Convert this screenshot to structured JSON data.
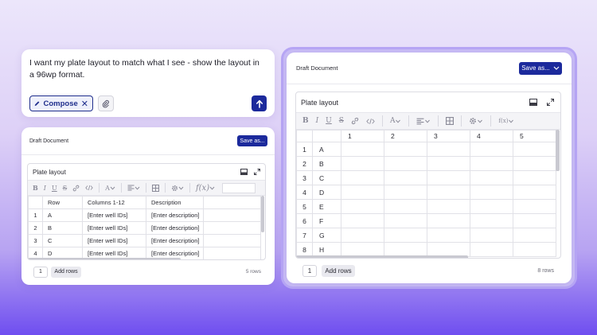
{
  "prompt": {
    "text": "I want my plate layout to match what I see - show the layout in a 96wp format.",
    "compose_label": "Compose",
    "compose_close": "✕"
  },
  "doc_small": {
    "title": "Draft Document",
    "save_label": "Save as...",
    "panel_title": "Plate layout",
    "columns": [
      "Row",
      "Columns 1-12",
      "Description"
    ],
    "rows": [
      {
        "num": "1",
        "row": "A",
        "cols": "[Enter well IDs]",
        "desc": "[Enter description]"
      },
      {
        "num": "2",
        "row": "B",
        "cols": "[Enter well IDs]",
        "desc": "[Enter description]"
      },
      {
        "num": "3",
        "row": "C",
        "cols": "[Enter well IDs]",
        "desc": "[Enter description]"
      },
      {
        "num": "4",
        "row": "D",
        "cols": "[Enter well IDs]",
        "desc": "[Enter description]"
      }
    ],
    "page_value": "1",
    "add_rows_label": "Add rows",
    "row_count": "5 rows"
  },
  "doc_big": {
    "title": "Draft Document",
    "save_label": "Save as...",
    "panel_title": "Plate layout",
    "columns": [
      "1",
      "2",
      "3",
      "4",
      "5"
    ],
    "rows": [
      {
        "num": "1",
        "label": "A"
      },
      {
        "num": "2",
        "label": "B"
      },
      {
        "num": "3",
        "label": "C"
      },
      {
        "num": "4",
        "label": "D"
      },
      {
        "num": "5",
        "label": "E"
      },
      {
        "num": "6",
        "label": "F"
      },
      {
        "num": "7",
        "label": "G"
      },
      {
        "num": "8",
        "label": "H"
      }
    ],
    "page_value": "1",
    "add_rows_label": "Add rows",
    "row_count": "8 rows"
  },
  "toolbar": {
    "bold": "B",
    "italic": "I",
    "underline": "U",
    "strike": "S",
    "text_color": "A",
    "function": "f(x)",
    "function_small": "f(x)"
  },
  "colors": {
    "accent": "#1c2a9c",
    "background_top": "#ece6fb",
    "background_bottom": "#6f4ef0"
  }
}
